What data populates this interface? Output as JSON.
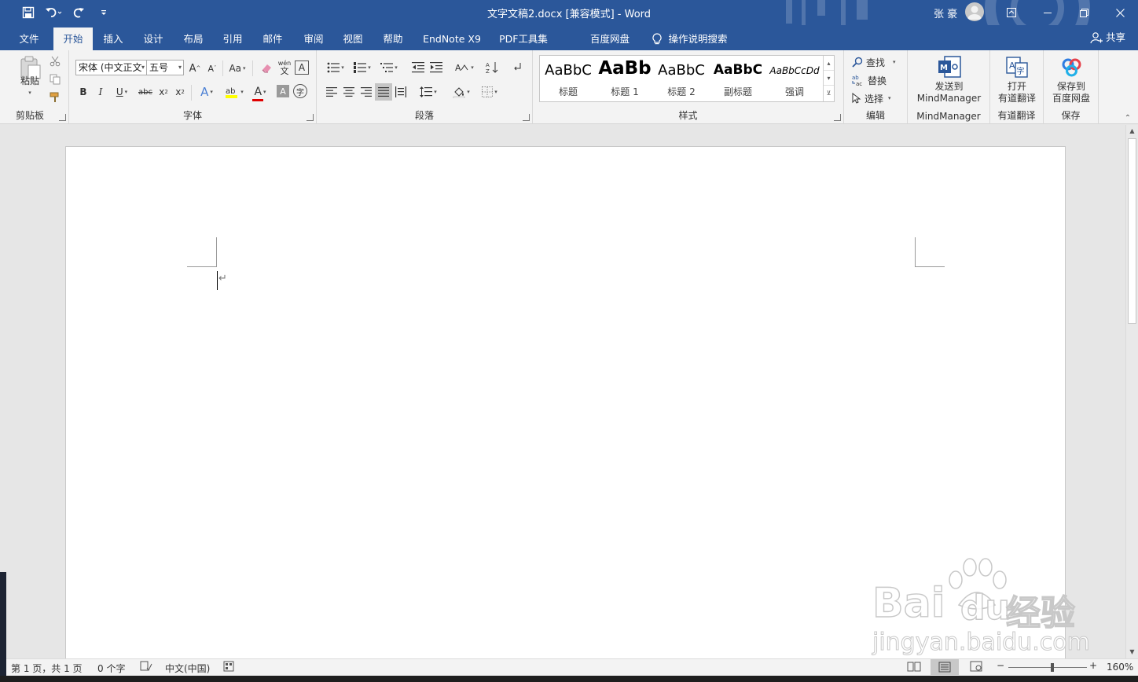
{
  "title": {
    "document": "文字文稿2.docx [兼容模式]  -  Word",
    "user": "张 豪"
  },
  "quick_access": {
    "save_icon": "save-icon",
    "undo_icon": "undo-icon",
    "redo_icon": "redo-icon",
    "customize_icon": "customize-qat-icon"
  },
  "tabs": [
    {
      "label": "文件"
    },
    {
      "label": "开始"
    },
    {
      "label": "插入"
    },
    {
      "label": "设计"
    },
    {
      "label": "布局"
    },
    {
      "label": "引用"
    },
    {
      "label": "邮件"
    },
    {
      "label": "审阅"
    },
    {
      "label": "视图"
    },
    {
      "label": "帮助"
    },
    {
      "label": "EndNote X9"
    },
    {
      "label": "PDF工具集"
    },
    {
      "label": "百度网盘"
    },
    {
      "label": "操作说明搜索"
    }
  ],
  "share_label": "共享",
  "ribbon": {
    "clipboard": {
      "label": "剪贴板",
      "paste": "粘贴"
    },
    "font": {
      "label": "字体",
      "font_name": "宋体 (中文正文",
      "font_size": "五号",
      "grow": "A",
      "shrink": "A",
      "case": "Aa",
      "bold": "B",
      "italic": "I",
      "underline": "U",
      "strike": "abc",
      "subscript": "x",
      "superscript": "x",
      "phonetic_top": "wén",
      "phonetic_bottom": "文",
      "char_border": "A",
      "text_effect": "A",
      "font_color": "A",
      "char_shading": "A",
      "enclose": "字"
    },
    "paragraph": {
      "label": "段落"
    },
    "styles": {
      "label": "样式",
      "items": [
        {
          "sample": "AaBbC",
          "name": "标题"
        },
        {
          "sample": "AaBb",
          "name": "标题 1"
        },
        {
          "sample": "AaBbC",
          "name": "标题 2"
        },
        {
          "sample": "AaBbC",
          "name": "副标题"
        },
        {
          "sample": "AaBbCcDd",
          "name": "强调"
        }
      ]
    },
    "editing": {
      "label": "编辑",
      "find": "查找",
      "replace": "替换",
      "select": "选择"
    },
    "mindmanager": {
      "label": "MindManager",
      "button_line1": "发送到",
      "button_line2": "MindManager"
    },
    "youdao": {
      "label": "有道翻译",
      "button_line1": "打开",
      "button_line2": "有道翻译"
    },
    "baidu": {
      "label": "保存",
      "button_line1": "保存到",
      "button_line2": "百度网盘"
    }
  },
  "document": {
    "paragraph_mark": "↵"
  },
  "status": {
    "page": "第 1 页，共 1 页",
    "words": "0 个字",
    "language": "中文(中国)",
    "zoom": "160%",
    "zoom_minus": "−",
    "zoom_plus": "+",
    "zoom_level_percent": 160
  },
  "watermark": {
    "brand": "Bai",
    "brand2": "du",
    "cn": "经验",
    "url": "jingyan.baidu.com"
  },
  "colors": {
    "accent": "#2b579a",
    "ribbon_bg": "#f3f3f3",
    "font_color_bar": "#e00000",
    "highlight_bar": "#ffff00"
  }
}
